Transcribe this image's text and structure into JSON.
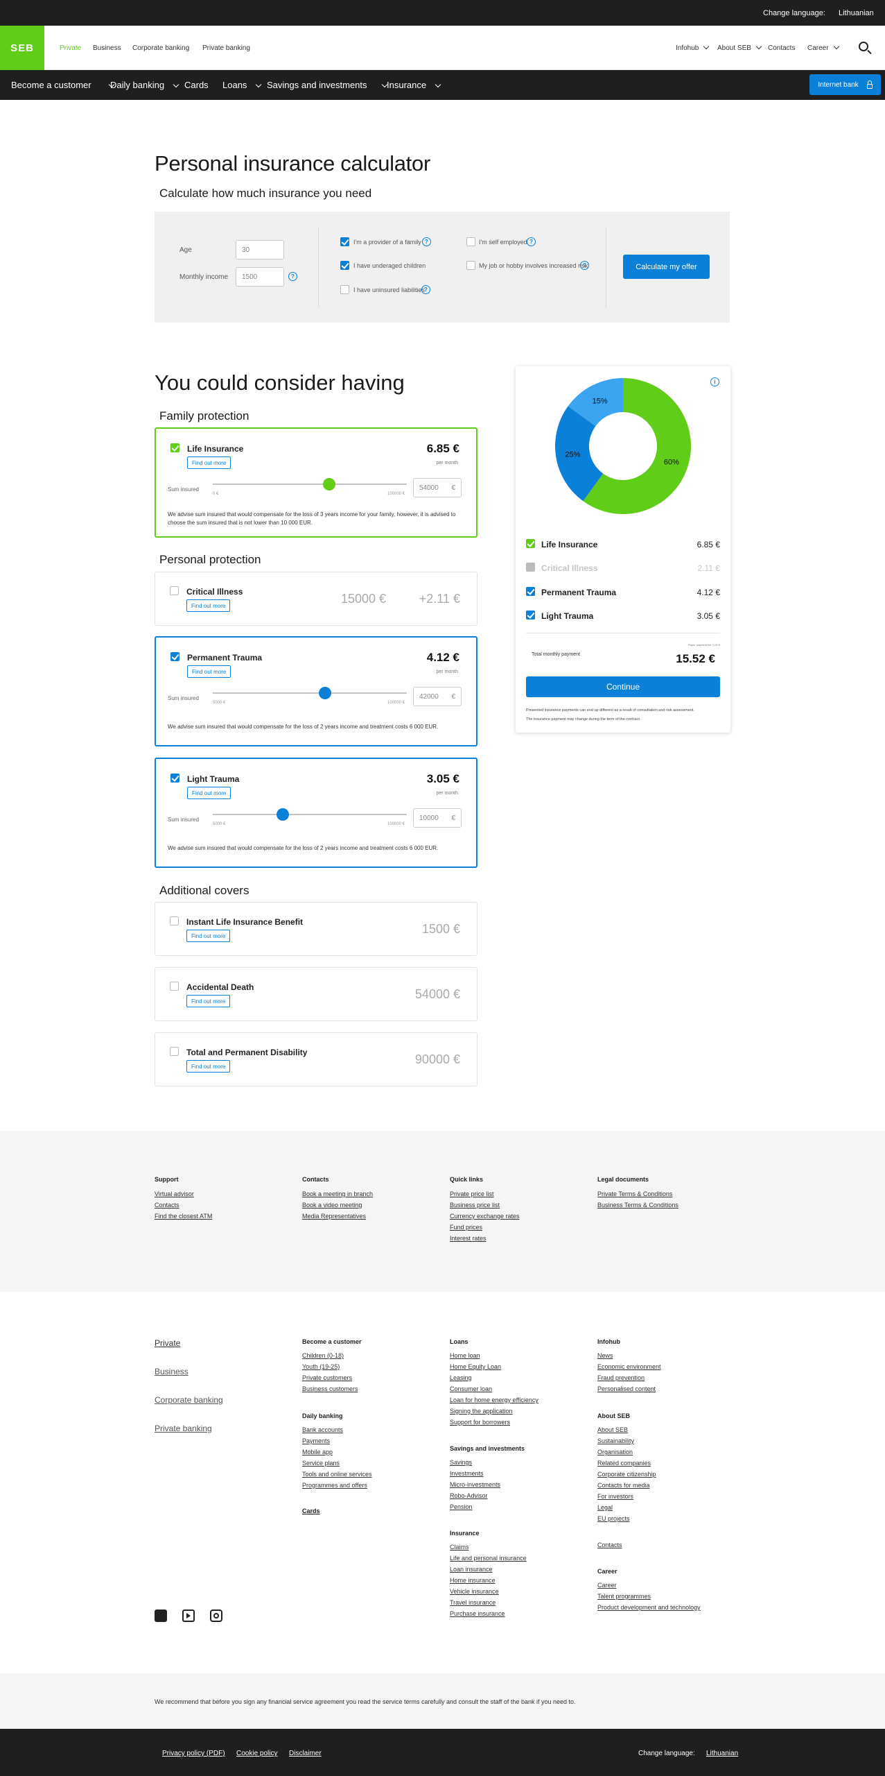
{
  "topbar": {
    "change_language": "Change language:",
    "language": "Lithuanian"
  },
  "brand": {
    "logo": "SEB",
    "green": "#60cd18",
    "blue": "#0a80d8",
    "dark": "#1f1f1f"
  },
  "mainnav": {
    "left": [
      "Private",
      "Business",
      "Corporate banking",
      "Private banking"
    ],
    "right": [
      "Infohub",
      "About SEB",
      "Contacts",
      "Career"
    ]
  },
  "subnav": {
    "items": [
      "Become a customer",
      "Daily banking",
      "Cards",
      "Loans",
      "Savings and investments",
      "Insurance"
    ],
    "internet_bank": "Internet bank"
  },
  "calculator": {
    "title": "Personal insurance calculator",
    "subtitle": "Calculate how much insurance you need",
    "age_label": "Age",
    "age_value": "30",
    "income_label": "Monthly income",
    "income_value": "1500",
    "help": "?",
    "options": [
      {
        "label": "I'm a provider of a family",
        "checked": true
      },
      {
        "label": "I have underaged children",
        "checked": true
      },
      {
        "label": "I have uninsured liabilities",
        "checked": false
      },
      {
        "label": "I'm self employed",
        "checked": false
      },
      {
        "label": "My job or hobby involves increased risk",
        "checked": false
      }
    ],
    "button": "Calculate my offer"
  },
  "results": {
    "title": "You could consider having",
    "family_title": "Family protection",
    "personal_title": "Personal protection",
    "additional_title": "Additional covers",
    "find_out_more": "Find out more",
    "per_month": "per month",
    "sum_insured": "Sum insured",
    "euro": "€",
    "life": {
      "name": "Life Insurance",
      "price": "6.85 €",
      "sum": "54000",
      "min": "0 €",
      "max": "100000 €",
      "slider": 0.6,
      "advice": "We advise sum insured that would compensate for the loss of 3 years income for your family, however, it is advised to choose the sum insured that is not lower than 10 000 EUR."
    },
    "critical": {
      "name": "Critical Illness",
      "sum": "15000 €",
      "price": "+2.11 €"
    },
    "trauma": {
      "name": "Permanent Trauma",
      "price": "4.12 €",
      "sum": "42000",
      "min": "5000 €",
      "max": "100000 €",
      "slider": 0.58,
      "advice": "We advise sum insured that would compensate for the loss of 2 years income and treatment costs 6 000 EUR."
    },
    "light": {
      "name": "Light Trauma",
      "price": "3.05 €",
      "sum": "10000",
      "min": "5000 €",
      "max": "100000 €",
      "slider": 0.36,
      "advice": "We advise sum insured that would compensate for the loss of 2 years income and treatment costs 6 000 EUR."
    },
    "additional": [
      {
        "name": "Instant Life Insurance Benefit",
        "sum": "1500 €"
      },
      {
        "name": "Accidental Death",
        "sum": "54000 €"
      },
      {
        "name": "Total and Permanent Disability",
        "sum": "90000 €"
      }
    ]
  },
  "summary": {
    "info": "i",
    "rows": [
      {
        "name": "Life Insurance",
        "value": "6.85 €",
        "on": true
      },
      {
        "name": "Critical Illness",
        "value": "2.11 €",
        "on": false
      },
      {
        "name": "Permanent Trauma",
        "value": "4.12 €",
        "on": true
      },
      {
        "name": "Light Trauma",
        "value": "3.05 €",
        "on": true
      }
    ],
    "total_label": "Total monthly payment",
    "total_note": "Paper payment fee 1,00 €",
    "total": "15.52 €",
    "continue": "Continue",
    "note1": "Presented insurance payments can end up different as a result of consultation and risk assessment.",
    "note2": "The insurance payment may change during the term of the contract."
  },
  "chart_data": {
    "type": "pie",
    "categories": [
      "Life Insurance",
      "Permanent Trauma",
      "Light Trauma"
    ],
    "values": [
      60,
      25,
      15
    ],
    "labels": [
      "60%",
      "25%",
      "15%"
    ],
    "colors": [
      "#60cd18",
      "#0a80d8",
      "#3aa4f0"
    ]
  },
  "footer_links": {
    "support": {
      "title": "Support",
      "links": [
        "Virtual advisor",
        "Contacts",
        "Find the closest ATM"
      ]
    },
    "contacts": {
      "title": "Contacts",
      "links": [
        "Book a meeting in branch",
        "Book a video meeting",
        "Media Representatives"
      ]
    },
    "quick": {
      "title": "Quick links",
      "links": [
        "Private price list",
        "Business price list",
        "Currency exchange rates",
        "Fund prices",
        "Interest rates"
      ]
    },
    "legal": {
      "title": "Legal documents",
      "links": [
        "Private Terms & Conditions",
        "Business Terms & Conditions"
      ]
    }
  },
  "sitemap": {
    "segments": [
      "Private",
      "Business",
      "Corporate banking",
      "Private banking"
    ],
    "become": {
      "title": "Become a customer",
      "links": [
        "Children (0-18)",
        "Youth (19-25)",
        "Private customers",
        "Business customers"
      ]
    },
    "daily": {
      "title": "Daily banking",
      "links": [
        "Bank accounts",
        "Payments",
        "Mobile app",
        "Service plans",
        "Tools and online services",
        "Programmes and offers"
      ]
    },
    "cards": {
      "title": "Cards"
    },
    "loans": {
      "title": "Loans",
      "links": [
        "Home loan",
        "Home Equity Loan",
        "Leasing",
        "Consumer loan",
        "Loan for home energy efficiency",
        "Signing the application",
        "Support for borrowers"
      ]
    },
    "savings": {
      "title": "Savings and investments",
      "links": [
        "Savings",
        "Investments",
        "Micro-investments",
        "Robo-Advisor",
        "Pension"
      ]
    },
    "insurance": {
      "title": "Insurance",
      "links": [
        "Claims",
        "Life and personal insurance",
        "Loan insurance",
        "Home insurance",
        "Vehicle insurance",
        "Travel insurance",
        "Purchase insurance"
      ]
    },
    "infohub": {
      "title": "Infohub",
      "links": [
        "News",
        "Economic environment",
        "Fraud prevention",
        "Personalised content"
      ]
    },
    "about": {
      "title": "About SEB",
      "links": [
        "About SEB",
        "Sustainability",
        "Organisation",
        "Related companies",
        "Corporate citizenship",
        "Contacts for media",
        "For investors",
        "Legal",
        "EU projects"
      ]
    },
    "contacts": "Contacts",
    "career": {
      "title": "Career",
      "links": [
        "Career",
        "Talent programmes",
        "Product development and technology"
      ]
    }
  },
  "disclaimer": "We recommend that before you sign any financial service agreement you read the service terms carefully and consult the staff of the bank if you need to.",
  "bottom": {
    "privacy": "Privacy policy (PDF)",
    "cookie": "Cookie policy",
    "disclaimer": "Disclaimer",
    "change_language": "Change language:",
    "language": "Lithuanian"
  }
}
